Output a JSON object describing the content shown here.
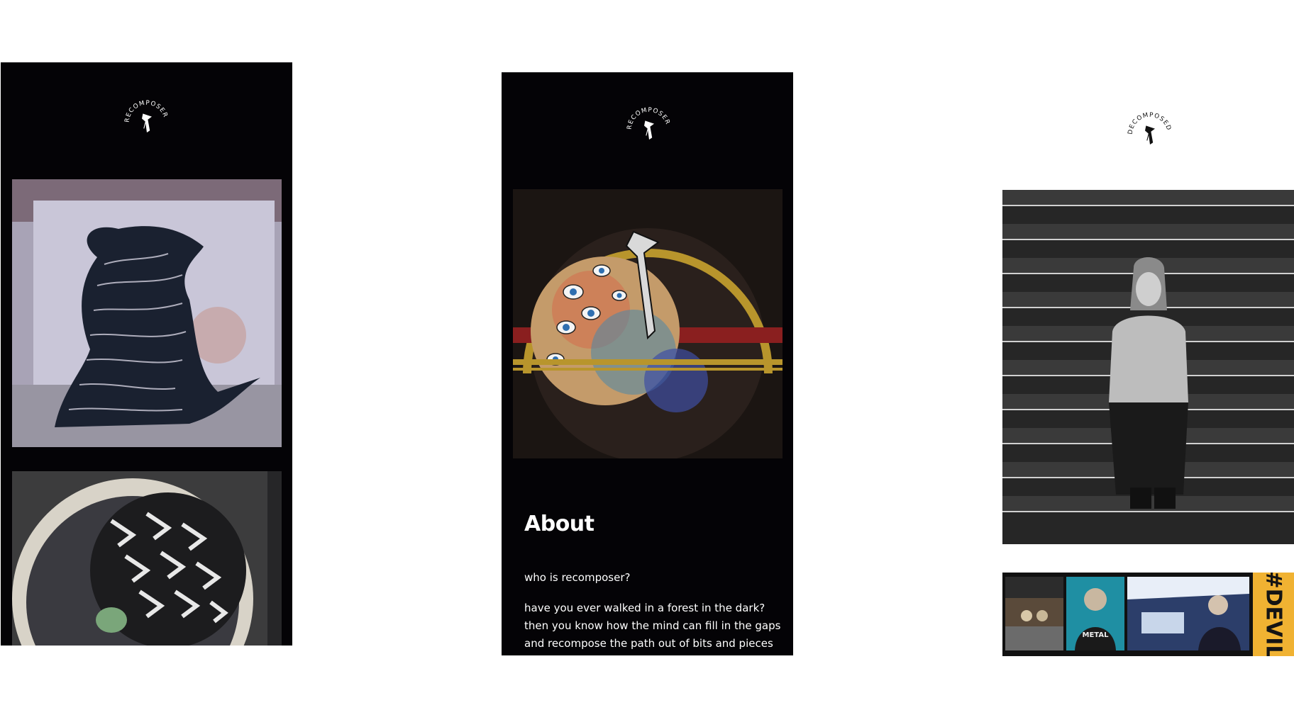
{
  "screens": [
    {
      "logo": {
        "text": "RECOMPOSER",
        "icon": "recomposer-logo-icon"
      }
    },
    {
      "logo": {
        "text": "RECOMPOSER",
        "icon": "recomposer-logo-icon"
      },
      "about": {
        "title": "About",
        "question": "who is recomposer?",
        "lines": [
          "have you ever walked in a forest in the dark?",
          "then you know how the mind can fill in the gaps",
          "and recompose the path out of bits and pieces"
        ]
      }
    },
    {
      "logo": {
        "text": "DECOMPOSED",
        "icon": "decomposed-logo-icon"
      },
      "tag": "#DEVIL"
    }
  ],
  "colors": {
    "dark_bg": "#040306",
    "accent_gold": "#b8952c",
    "accent_red": "#8a1f1f",
    "tag_yellow": "#f0b232"
  }
}
